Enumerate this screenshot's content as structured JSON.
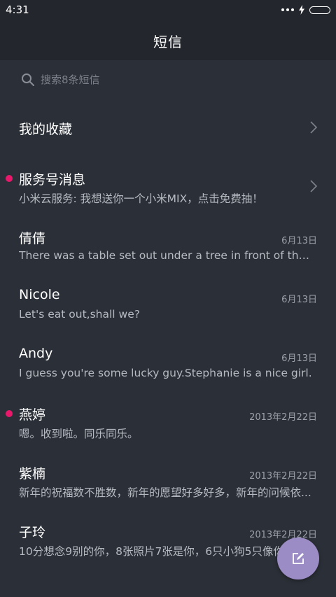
{
  "status_bar": {
    "time": "4:31"
  },
  "header": {
    "title": "短信"
  },
  "search": {
    "placeholder": "搜索8条短信"
  },
  "favorites": {
    "label": "我的收藏"
  },
  "service_messages": {
    "title": "服务号消息",
    "preview": "小米云服务: 我想送你一个小米MIX，点击免费抽！",
    "unread": true
  },
  "conversations": [
    {
      "name": "倩倩",
      "preview": "There was a table set out under a tree in front of the hous",
      "date": "6月13日",
      "unread": false
    },
    {
      "name": "Nicole",
      "preview": "Let's eat out,shall we?",
      "date": "6月13日",
      "unread": false
    },
    {
      "name": "Andy",
      "preview": "I guess you're some lucky guy.Stephanie is a nice girl.",
      "date": "6月13日",
      "unread": false
    },
    {
      "name": "燕婷",
      "preview": "嗯。收到啦。同乐同乐。",
      "date": "2013年2月22日",
      "unread": true
    },
    {
      "name": "紫楠",
      "preview": "新年的祝福数不胜数，新年的愿望好多好多，新年的问候依...",
      "date": "2013年2月22日",
      "unread": false
    },
    {
      "name": "子玲",
      "preview": "10分想念9别的你，8张照片7张是你，6只小狗5只像你",
      "date": "2013年2月22日",
      "unread": false
    }
  ],
  "colors": {
    "background": "#2b2f37",
    "header": "#23262c",
    "unread_dot": "#e8196b",
    "fab": "#9b8cc5"
  },
  "icons": {
    "search": "search-icon",
    "chevron": "chevron-right-icon",
    "compose": "compose-icon",
    "more": "more-dots-icon",
    "charging": "charging-bolt-icon",
    "battery": "battery-icon"
  }
}
